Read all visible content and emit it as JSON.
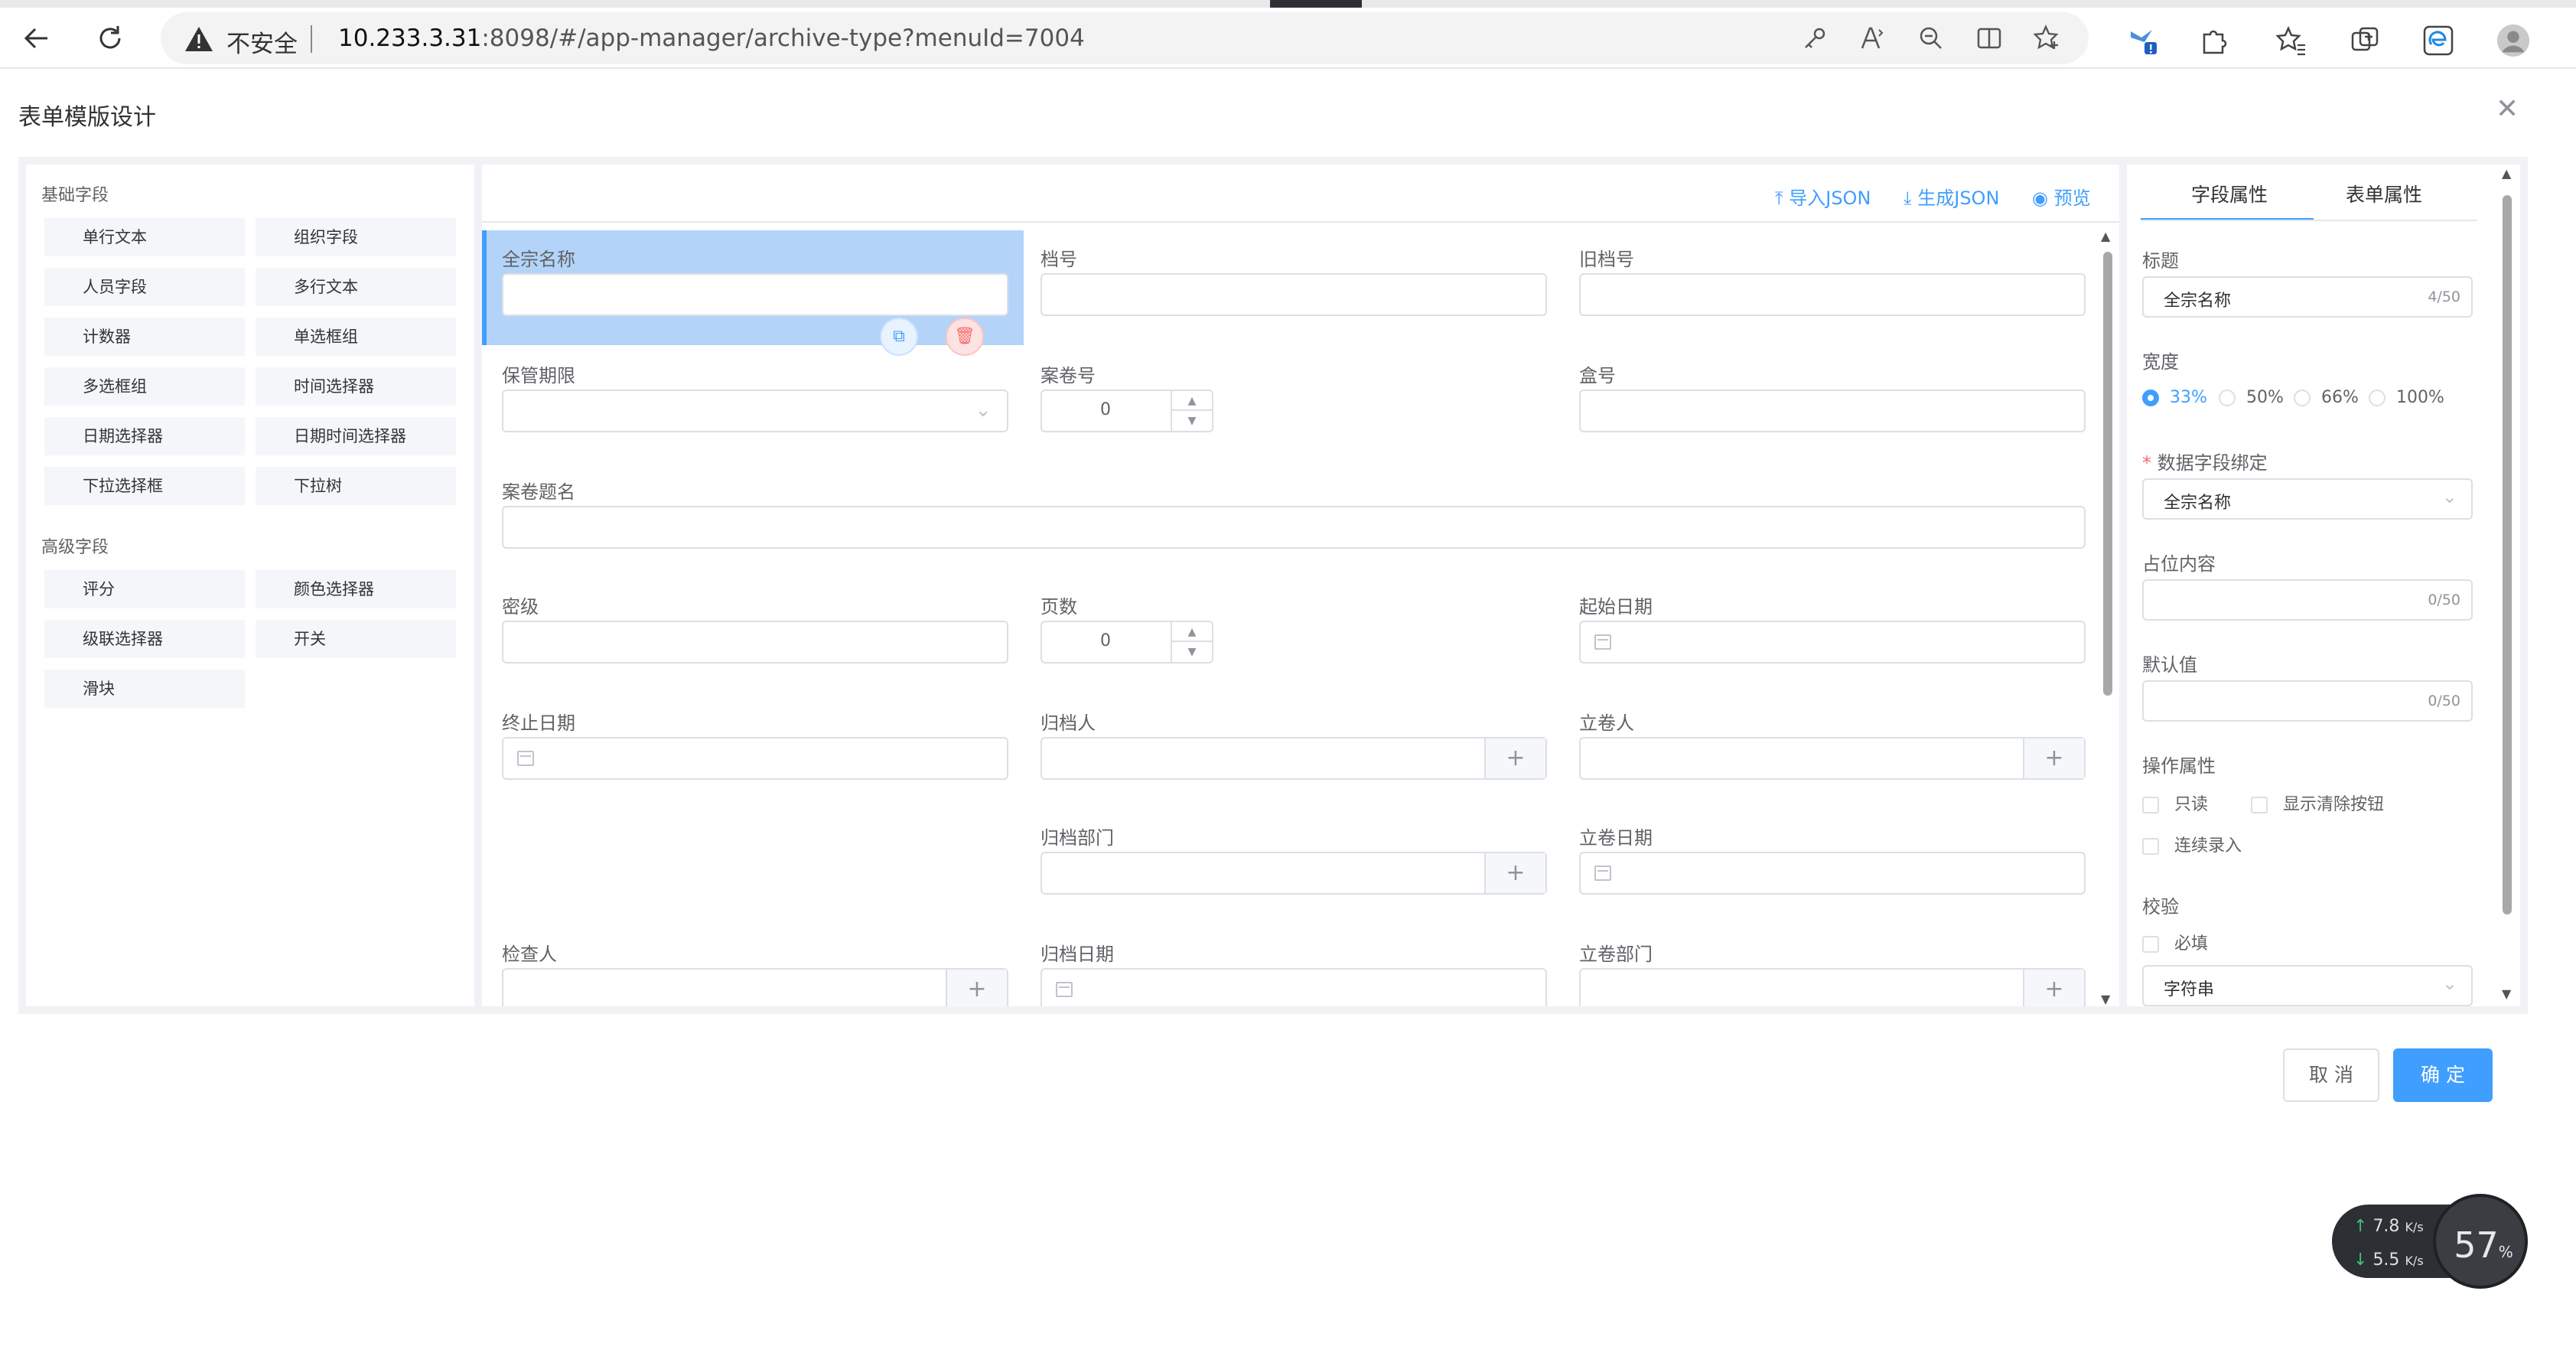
{
  "browser": {
    "security_label": "不安全",
    "url_host": "10.233.3.31",
    "url_rest": ":8098/#/app-manager/archive-type?menuId=7004"
  },
  "dialog": {
    "title": "表单模版设计",
    "cancel_label": "取 消",
    "confirm_label": "确 定"
  },
  "palette": {
    "basic_title": "基础字段",
    "basic_items": [
      "单行文本",
      "组织字段",
      "人员字段",
      "多行文本",
      "计数器",
      "单选框组",
      "多选框组",
      "时间选择器",
      "日期选择器",
      "日期时间选择器",
      "下拉选择框",
      "下拉树"
    ],
    "advanced_title": "高级字段",
    "advanced_items": [
      "评分",
      "颜色选择器",
      "级联选择器",
      "开关",
      "滑块"
    ]
  },
  "toolbar": {
    "import_label": "导入JSON",
    "generate_label": "生成JSON",
    "preview_label": "预览"
  },
  "form": {
    "fields": {
      "quanzong": "全宗名称",
      "danghao": "档号",
      "jiudanghao": "旧档号",
      "baoguan": "保管期限",
      "anjuanhao": "案卷号",
      "anjuanhao_value": "0",
      "hehao": "盒号",
      "anjuan_title": "案卷题名",
      "miji": "密级",
      "yeshu": "页数",
      "yeshu_value": "0",
      "qishi": "起始日期",
      "zhongzhi": "终止日期",
      "guidangren": "归档人",
      "lijuanren": "立卷人",
      "guidang_dept": "归档部门",
      "lijuan_date": "立卷日期",
      "jianchaaren": "检查人",
      "guidang_date": "归档日期",
      "lijuan_dept": "立卷部门"
    }
  },
  "props": {
    "tab_field": "字段属性",
    "tab_form": "表单属性",
    "title_label": "标题",
    "title_value": "全宗名称",
    "title_count": "4/50",
    "width_label": "宽度",
    "width_options": [
      "33%",
      "50%",
      "66%",
      "100%"
    ],
    "width_selected": "33%",
    "binding_label": "数据字段绑定",
    "binding_value": "全宗名称",
    "placeholder_label": "占位内容",
    "placeholder_count": "0/50",
    "default_label": "默认值",
    "default_count": "0/50",
    "ops_label": "操作属性",
    "readonly_label": "只读",
    "clearable_label": "显示清除按钮",
    "continuous_label": "连续录入",
    "validate_label": "校验",
    "required_label": "必填",
    "validate_type": "字符串"
  },
  "network": {
    "up": "7.8",
    "down": "5.5",
    "unit": "K/s",
    "percent": "57",
    "percent_sign": "%"
  },
  "colors": {
    "accent": "#409eff",
    "selected_bg": "#b3d4f8",
    "danger": "#f56c6c"
  }
}
